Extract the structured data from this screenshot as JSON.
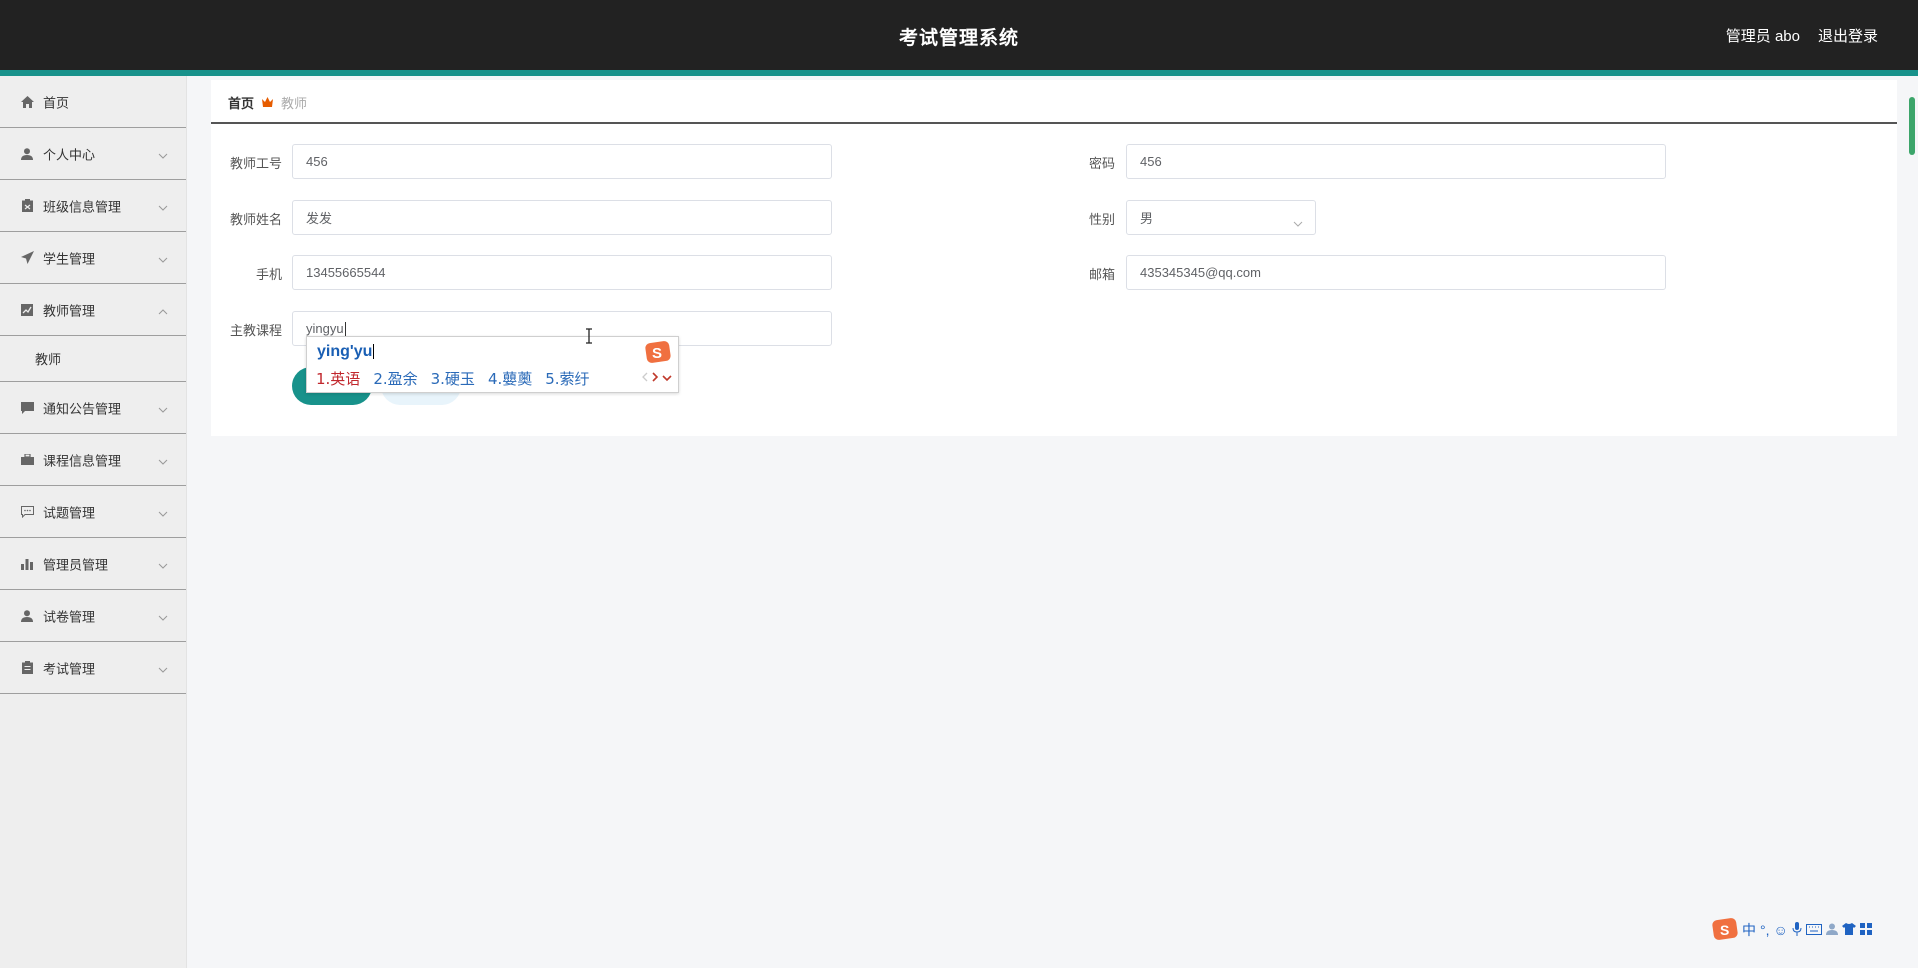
{
  "header": {
    "title": "考试管理系统",
    "admin": "管理员 abo",
    "logout": "退出登录"
  },
  "colors": {
    "header_bg": "#222222",
    "accent": "#18928b",
    "ime_blue": "#2a6ab8",
    "ime_red": "#c1272d"
  },
  "sidebar": {
    "items": [
      {
        "label": "首页",
        "icon": "home-icon"
      },
      {
        "label": "个人中心",
        "icon": "user-icon"
      },
      {
        "label": "班级信息管理",
        "icon": "clipboard-icon"
      },
      {
        "label": "学生管理",
        "icon": "paper-plane-icon"
      },
      {
        "label": "教师管理",
        "icon": "chart-box-icon",
        "expanded": true,
        "children": [
          "教师"
        ]
      },
      {
        "label": "通知公告管理",
        "icon": "message-icon"
      },
      {
        "label": "课程信息管理",
        "icon": "briefcase-icon"
      },
      {
        "label": "试题管理",
        "icon": "comment-icon"
      },
      {
        "label": "管理员管理",
        "icon": "bar-chart-icon"
      },
      {
        "label": "试卷管理",
        "icon": "user-icon"
      },
      {
        "label": "考试管理",
        "icon": "clipboard-icon"
      }
    ]
  },
  "breadcrumb": {
    "home": "首页",
    "current": "教师"
  },
  "form": {
    "teacher_id_label": "教师工号",
    "teacher_id": "456",
    "password_label": "密码",
    "password": "456",
    "name_label": "教师姓名",
    "name": "发发",
    "gender_label": "性别",
    "gender": "男",
    "phone_label": "手机",
    "phone": "13455665544",
    "email_label": "邮箱",
    "email": "435345345@qq.com",
    "course_label": "主教课程",
    "course": "yingyu"
  },
  "ime": {
    "composition": "ying'yu",
    "candidates": [
      "1.英语",
      "2.盈余",
      "3.硬玉",
      "4.蘡薁",
      "5.萦纡"
    ]
  },
  "tray": {
    "mode": "中"
  }
}
